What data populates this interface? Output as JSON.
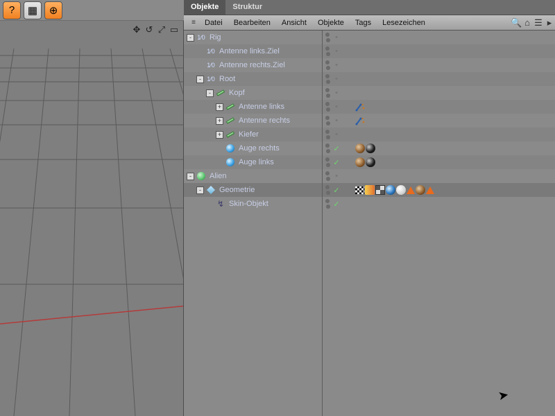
{
  "topToolbar": {
    "select": "?",
    "menu": "▦",
    "web": "⊕"
  },
  "vpCtrls": [
    "✥",
    "↺",
    "⤢",
    "▭"
  ],
  "tabs": {
    "active": "Objekte",
    "other": "Struktur"
  },
  "menu": {
    "items": [
      "Datei",
      "Bearbeiten",
      "Ansicht",
      "Objekte",
      "Tags",
      "Lesezeichen"
    ]
  },
  "tree": [
    {
      "d": 0,
      "exp": "-",
      "icon": "null",
      "label": "Rig",
      "en": "off",
      "tags": []
    },
    {
      "d": 1,
      "exp": " ",
      "icon": "null",
      "label": "Antenne links.Ziel",
      "en": "off",
      "tags": []
    },
    {
      "d": 1,
      "exp": " ",
      "icon": "null",
      "label": "Antenne rechts.Ziel",
      "en": "off",
      "tags": []
    },
    {
      "d": 1,
      "exp": "-",
      "icon": "null",
      "label": "Root",
      "en": "off",
      "tags": []
    },
    {
      "d": 2,
      "exp": "-",
      "icon": "bone",
      "label": "Kopf",
      "en": "off",
      "tags": []
    },
    {
      "d": 3,
      "exp": "+",
      "icon": "bone",
      "label": "Antenne links",
      "en": "off",
      "tags": [
        "ik"
      ]
    },
    {
      "d": 3,
      "exp": "+",
      "icon": "bone",
      "label": "Antenne rechts",
      "en": "off",
      "tags": [
        "ik"
      ]
    },
    {
      "d": 3,
      "exp": "+",
      "icon": "bone",
      "label": "Kiefer",
      "en": "off",
      "tags": []
    },
    {
      "d": 3,
      "exp": " ",
      "icon": "sphere",
      "label": "Auge rechts",
      "en": "on",
      "tags": [
        "brown",
        "black"
      ]
    },
    {
      "d": 3,
      "exp": " ",
      "icon": "sphere",
      "label": "Auge links",
      "en": "on",
      "tags": [
        "brown",
        "black"
      ]
    },
    {
      "d": 0,
      "exp": "-",
      "icon": "nullsq",
      "label": "Alien",
      "en": "off",
      "tags": []
    },
    {
      "d": 1,
      "exp": "-",
      "icon": "poly",
      "label": "Geometrie",
      "en": "on",
      "sel": true,
      "tags": [
        "flag",
        "weight",
        "check",
        "blue",
        "white",
        "tri",
        "brown",
        "tri"
      ]
    },
    {
      "d": 2,
      "exp": " ",
      "icon": "skin",
      "label": "Skin-Objekt",
      "en": "on",
      "tags": []
    }
  ]
}
